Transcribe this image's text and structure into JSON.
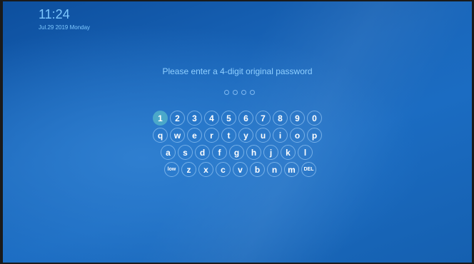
{
  "status": {
    "time": "11:24",
    "date": "Jul.29 2019 Monday"
  },
  "prompt": "Please enter a 4-digit original password",
  "pin": {
    "length": 4,
    "entered": 0
  },
  "keyboard": {
    "row1": [
      "1",
      "2",
      "3",
      "4",
      "5",
      "6",
      "7",
      "8",
      "9",
      "0"
    ],
    "row2": [
      "q",
      "w",
      "e",
      "r",
      "t",
      "y",
      "u",
      "i",
      "o",
      "p"
    ],
    "row3": [
      "a",
      "s",
      "d",
      "f",
      "g",
      "h",
      "j",
      "k",
      "l"
    ],
    "row4": [
      "low",
      "z",
      "x",
      "c",
      "v",
      "b",
      "n",
      "m",
      "DEL"
    ],
    "focused_key": "1"
  },
  "colors": {
    "accent": "#4ba8c9",
    "text": "#7ec8ff",
    "background": "#1a67bb"
  }
}
